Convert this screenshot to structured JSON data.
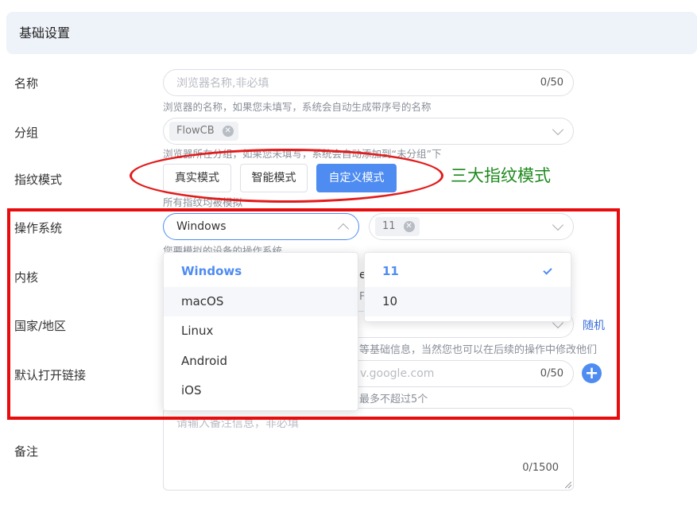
{
  "section": {
    "title": "基础设置"
  },
  "name": {
    "label": "名称",
    "placeholder": "浏览器名称,非必填",
    "count": "0/50",
    "hint": "浏览器的名称，如果您未填写，系统会自动生成带序号的名称"
  },
  "group": {
    "label": "分组",
    "tag": "FlowCB",
    "hint": "浏览器所在分组，如果您未填写，系统会自动添加到“未分组”下"
  },
  "fingerprint": {
    "label": "指纹模式",
    "modes": [
      "真实模式",
      "智能模式",
      "自定义模式"
    ],
    "active_mode": "自定义模式",
    "hint": "所有指纹均被模拟"
  },
  "annotation": {
    "text": "三大指纹模式",
    "color": "#1e8a1e"
  },
  "os": {
    "label": "操作系统",
    "value": "Windows",
    "version_tag": "11",
    "hint": "您要模拟的设备的操作系统",
    "options": [
      "Windows",
      "macOS",
      "Linux",
      "Android",
      "iOS"
    ],
    "selected": "Windows",
    "version_options": [
      "11",
      "10"
    ],
    "version_selected": "11"
  },
  "kernel": {
    "label": "内核",
    "peek_a": "e",
    "peek_b": "F"
  },
  "country": {
    "label": "国家/地区",
    "random_link": "随机",
    "hint_tail": "等基础信息，当然您也可以在后续的操作中修改他们"
  },
  "default_url": {
    "label": "默认打开链接",
    "placeholder_tail": "v.google.com",
    "count": "0/50",
    "hint_tail": "最多不超过5个"
  },
  "notes": {
    "label": "备注",
    "placeholder": "请输入备注信息，非必填",
    "count": "0/1500"
  },
  "colors": {
    "accent": "#4e8cf2",
    "annotation_red": "#e80c0c"
  }
}
